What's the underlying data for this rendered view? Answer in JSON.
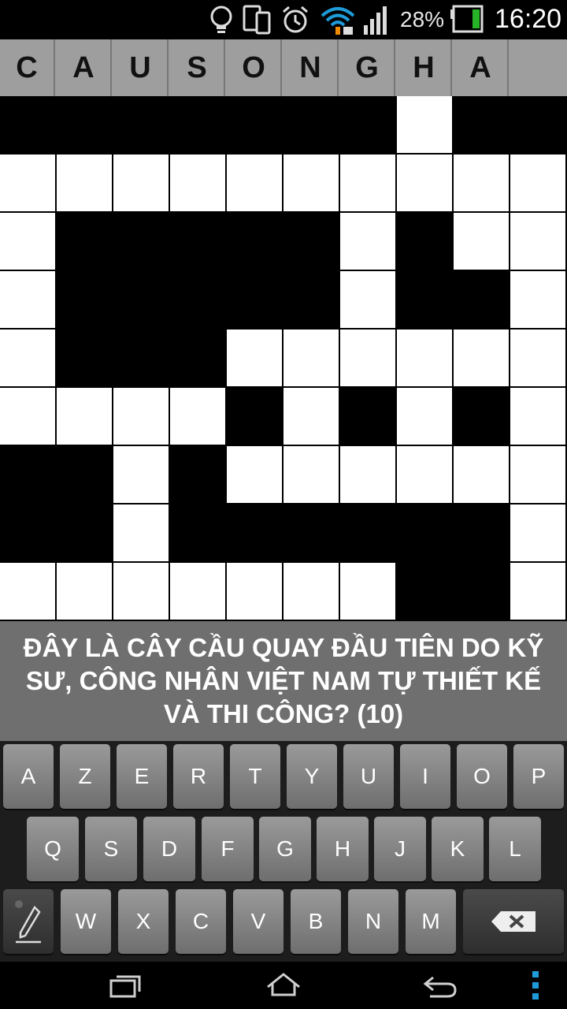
{
  "status_bar": {
    "battery_percent": "28%",
    "time": "16:20",
    "icons": [
      "lightbulb-icon",
      "phone-tablet-icon",
      "alarm-icon",
      "wifi-icon",
      "signal-icon",
      "battery-icon"
    ]
  },
  "answer": {
    "letters": [
      "C",
      "A",
      "U",
      "S",
      "O",
      "N",
      "G",
      "H",
      "A",
      ""
    ]
  },
  "grid": {
    "rows": 9,
    "cols": 10,
    "pattern": [
      "0000000100",
      "1111111111",
      "1000001011",
      "1000001001",
      "1000111111",
      "1111010101",
      "0010111111",
      "0010000001",
      "1111111001"
    ]
  },
  "clue": {
    "text": "ĐÂY LÀ CÂY CẦU QUAY ĐẦU TIÊN DO KỸ SƯ, CÔNG NHÂN VIỆT NAM TỰ THIẾT KẾ VÀ THI CÔNG? (10)"
  },
  "keyboard": {
    "row1": [
      "A",
      "Z",
      "E",
      "R",
      "T",
      "Y",
      "U",
      "I",
      "O",
      "P"
    ],
    "row2": [
      "Q",
      "S",
      "D",
      "F",
      "G",
      "H",
      "J",
      "K",
      "L"
    ],
    "row3": [
      "W",
      "X",
      "C",
      "V",
      "B",
      "N",
      "M"
    ],
    "special_icons": [
      "pen-icon",
      "backspace-icon"
    ]
  },
  "nav_bar": {
    "icons": [
      "recent-apps-icon",
      "home-icon",
      "back-icon",
      "menu-icon"
    ]
  }
}
